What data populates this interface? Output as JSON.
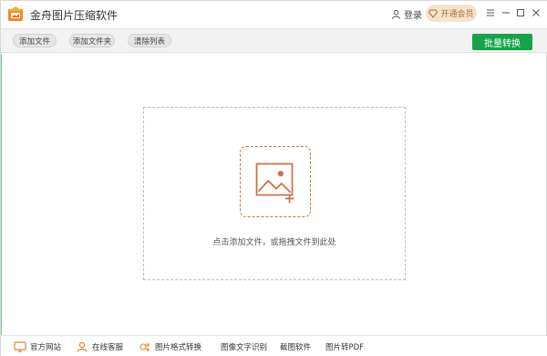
{
  "app": {
    "title": "金舟图片压缩软件",
    "icon": "app-logo-icon"
  },
  "header": {
    "login_label": "登录",
    "vip_label": "开通会员",
    "vip_icon": "diamond-icon",
    "window_controls": [
      "menu-icon",
      "minimize-icon",
      "maximize-icon",
      "close-icon"
    ]
  },
  "toolbar": {
    "add_file": "添加文件",
    "add_folder": "添加文件夹",
    "clear_list": "清除列表",
    "batch_convert": "批量转换"
  },
  "dropzone": {
    "icon": "add-image-icon",
    "hint": "点击添加文件，或拖拽文件到此处"
  },
  "footer": {
    "items": [
      {
        "label": "官方网站",
        "icon": "monitor-icon"
      },
      {
        "label": "在线客服",
        "icon": "support-icon"
      },
      {
        "label": "图片格式转换",
        "icon": "app-link-icon"
      },
      {
        "label": "图像文字识别",
        "icon": ""
      },
      {
        "label": "截图软件",
        "icon": ""
      },
      {
        "label": "图片转PDF",
        "icon": ""
      }
    ]
  },
  "colors": {
    "accent_green": "#16a34a",
    "accent_orange": "#c8714a",
    "vip_bg": "#f3e4cf"
  }
}
